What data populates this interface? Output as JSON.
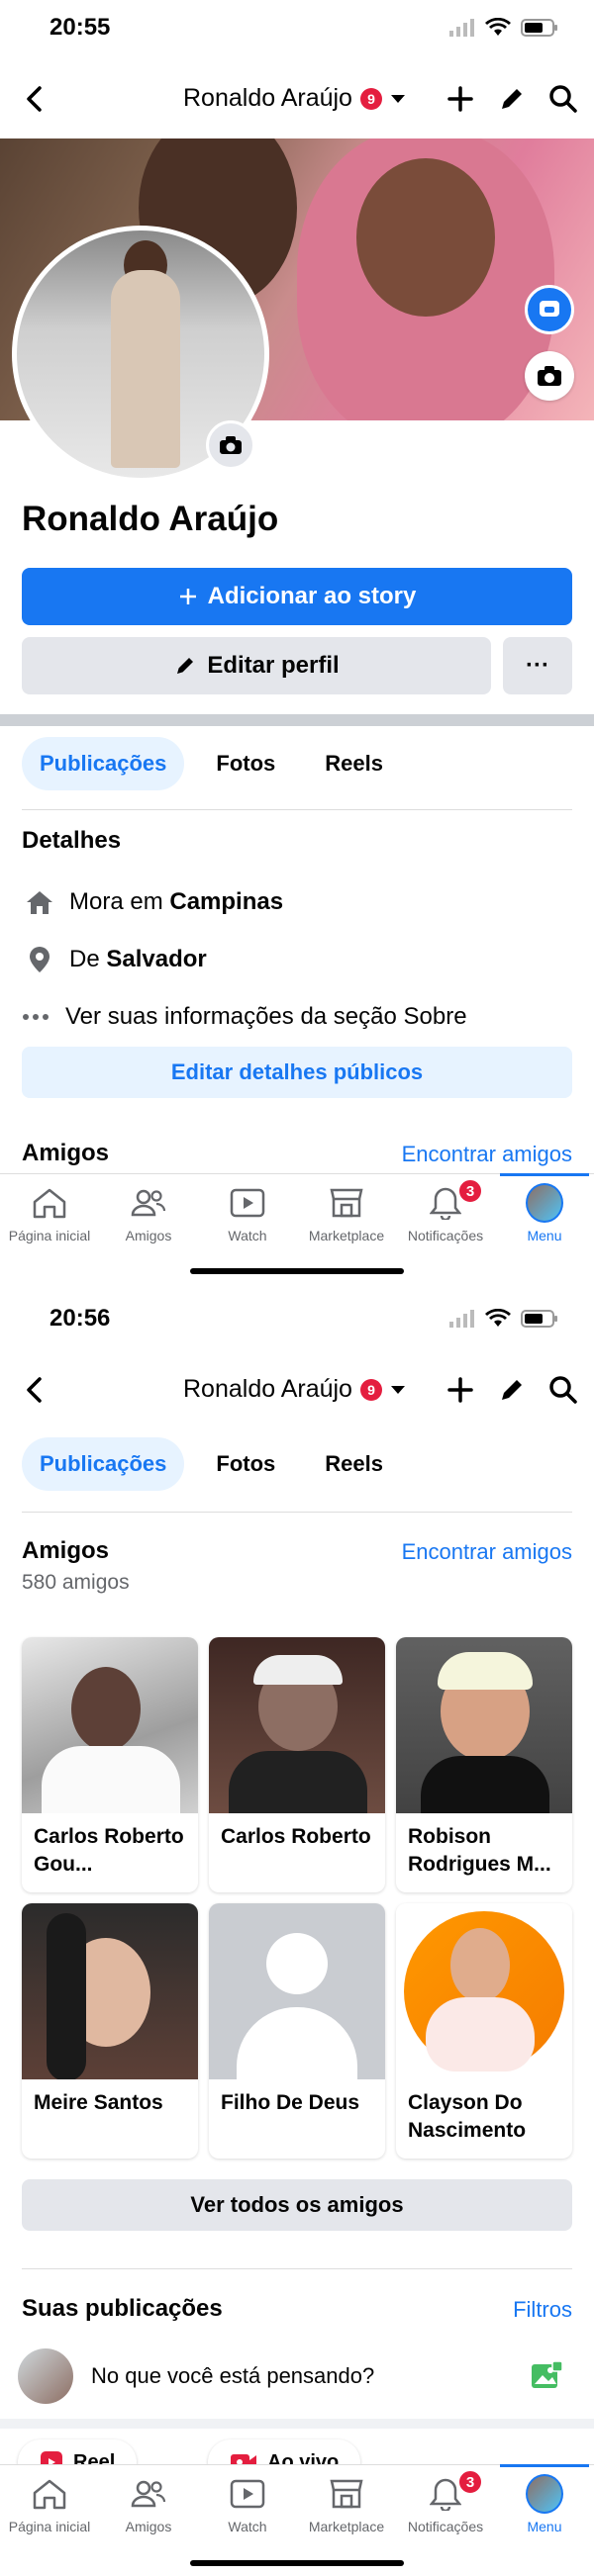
{
  "screen1": {
    "status": {
      "time": "20:55"
    },
    "topbar": {
      "title": "Ronaldo Araújo",
      "badge": "9"
    },
    "profile": {
      "name": "Ronaldo Araújo"
    },
    "actions": {
      "add_story": "Adicionar ao story",
      "edit_profile": "Editar perfil",
      "more": "···"
    },
    "tabs": [
      "Publicações",
      "Fotos",
      "Reels"
    ],
    "details": {
      "heading": "Detalhes",
      "lives_prefix": "Mora em",
      "lives_city": "Campinas",
      "from_prefix": "De",
      "from_city": "Salvador",
      "about": "Ver suas informações da seção Sobre",
      "edit_button": "Editar detalhes públicos"
    },
    "friends": {
      "heading": "Amigos",
      "find": "Encontrar amigos"
    }
  },
  "screen2": {
    "status": {
      "time": "20:56"
    },
    "topbar": {
      "title": "Ronaldo Araújo",
      "badge": "9"
    },
    "tabs": [
      "Publicações",
      "Fotos",
      "Reels"
    ],
    "friends": {
      "heading": "Amigos",
      "count": "580 amigos",
      "find": "Encontrar amigos",
      "list": [
        {
          "name": "Carlos Roberto Gou..."
        },
        {
          "name": "Carlos Roberto"
        },
        {
          "name": "Robison Rodrigues M..."
        },
        {
          "name": "Meire Santos"
        },
        {
          "name": "Filho De Deus"
        },
        {
          "name": "Clayson Do Nascimento"
        }
      ],
      "see_all": "Ver todos os amigos"
    },
    "posts": {
      "heading": "Suas publicações",
      "filters": "Filtros",
      "composer": "No que você está pensando?"
    },
    "chips": {
      "reel": "Reel",
      "live": "Ao vivo"
    }
  },
  "bottom_nav": {
    "items": [
      {
        "label": "Página inicial",
        "icon": "home-icon"
      },
      {
        "label": "Amigos",
        "icon": "friends-icon"
      },
      {
        "label": "Watch",
        "icon": "watch-icon"
      },
      {
        "label": "Marketplace",
        "icon": "marketplace-icon"
      },
      {
        "label": "Notificações",
        "icon": "bell-icon",
        "badge": "3"
      },
      {
        "label": "Menu",
        "icon": "menu-avatar"
      }
    ]
  },
  "colors": {
    "accent": "#1877f2",
    "badge": "#e41e3f",
    "light_accent": "#e7f3ff",
    "gray_button": "#e4e6eb"
  }
}
